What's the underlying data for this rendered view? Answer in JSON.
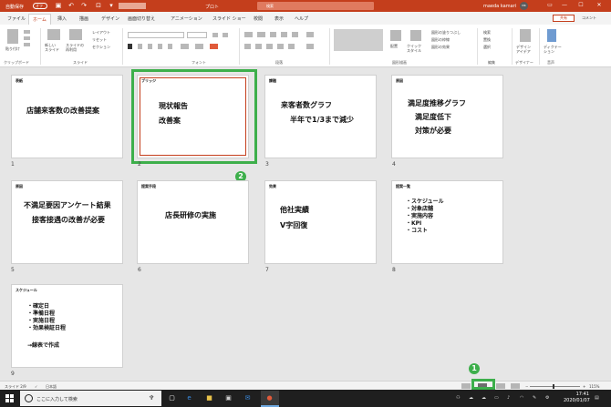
{
  "titlebar": {
    "autosave_label": "自動保存",
    "autosave_state": "オフ",
    "filename": "プロト",
    "search_placeholder": "検索",
    "username": "maeda kamari",
    "avatar_initials": "MK",
    "undo_glyph": "↶",
    "redo_glyph": "↷",
    "save_glyph": "▣",
    "start_glyph": "⊡",
    "more_glyph": "▾",
    "ribbon_opt_glyph": "▭",
    "min_glyph": "—",
    "max_glyph": "☐",
    "close_glyph": "✕"
  },
  "tabs": [
    "ファイル",
    "ホーム",
    "挿入",
    "描画",
    "デザイン",
    "画面切り替え",
    "アニメーション",
    "スライド ショー",
    "校閲",
    "表示",
    "ヘルプ"
  ],
  "active_tab_index": 1,
  "share_label": "共有",
  "comment_label": "コメント",
  "ribbon": {
    "groups": {
      "clipboard": "クリップボード",
      "slides": "スライド",
      "font": "フォント",
      "paragraph": "段落",
      "drawing": "図形描画",
      "editing": "編集",
      "designer": "デザイナー",
      "voice": "音声"
    },
    "paste": "貼り付け",
    "new_slide": "新しい\nスライド",
    "reuse_slides": "スライドの\n再利用",
    "layout": "レイアウト",
    "reset": "リセット",
    "section": "セクション",
    "arrange": "配置",
    "quick_styles": "クイック\nスタイル",
    "shape_fill": "図形の塗りつぶし",
    "shape_outline": "図形の枠線",
    "shape_effects": "図形の効果",
    "find": "検索",
    "replace": "置換",
    "select": "選択",
    "design_ideas": "デザイン\nアイデア",
    "dictate": "ディクテー\nション"
  },
  "slides": [
    {
      "number": "1",
      "label": "表紙",
      "lines": [
        "店舗来客数の改善提案"
      ],
      "style": "center"
    },
    {
      "number": "2",
      "label": "ブリッジ",
      "lines": [
        "現状報告",
        "改善案"
      ],
      "style": "left",
      "selected": true
    },
    {
      "number": "3",
      "label": "課題",
      "lines": [
        "来客者数グラフ",
        "半年で1/3まで減少"
      ],
      "style": "center"
    },
    {
      "number": "4",
      "label": "原因",
      "lines": [
        "満足度推移グラフ",
        "満足度低下",
        "対策が必要"
      ],
      "style": "center"
    },
    {
      "number": "5",
      "label": "原因",
      "lines": [
        "不満足要因アンケート結果",
        "接客接遇の改善が必要"
      ],
      "style": "center"
    },
    {
      "number": "6",
      "label": "提案手段",
      "lines": [
        "店長研修の実施"
      ],
      "style": "center"
    },
    {
      "number": "7",
      "label": "効果",
      "lines": [
        "他社実績",
        "V字回復"
      ],
      "style": "left"
    },
    {
      "number": "8",
      "label": "提案一覧",
      "lines": [
        "・スケジュール",
        "・対象店舗",
        "・実施内容",
        "・KPI",
        "・コスト"
      ],
      "style": "list"
    },
    {
      "number": "9",
      "label": "スケジュール",
      "lines": [
        "・確定日",
        "・準備日程",
        "・実施日程",
        "・効果検証日程",
        "",
        "→線表で作成"
      ],
      "style": "list"
    }
  ],
  "callouts": {
    "one": "1",
    "two": "2"
  },
  "statusbar": {
    "slide_position": "スライド 2/9",
    "language": "日本語",
    "zoom": "115%",
    "zoom_out": "−",
    "zoom_in": "+"
  },
  "taskbar": {
    "search_placeholder": "ここに入力して検索",
    "mic_glyph": "♆",
    "time": "17:41",
    "date": "2020/01/07"
  }
}
